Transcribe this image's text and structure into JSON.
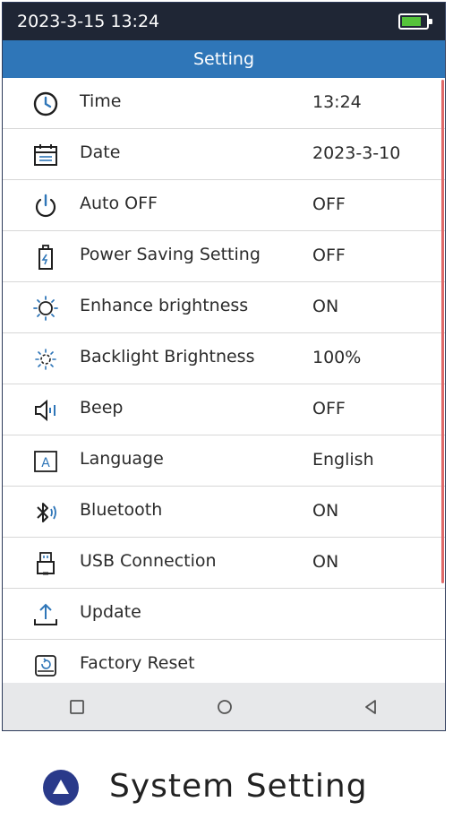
{
  "status": {
    "datetime": "2023-3-15 13:24",
    "battery_color": "#55c33b",
    "battery_level": 0.8
  },
  "header": {
    "title": "Setting"
  },
  "items": [
    {
      "icon": "clock-icon",
      "label": "Time",
      "value": "13:24"
    },
    {
      "icon": "calendar-icon",
      "label": "Date",
      "value": "2023-3-10"
    },
    {
      "icon": "power-icon",
      "label": "Auto OFF",
      "value": "OFF"
    },
    {
      "icon": "battery-saver-icon",
      "label": "Power Saving Setting",
      "value": "OFF"
    },
    {
      "icon": "brightness-enhance-icon",
      "label": "Enhance brightness",
      "value": "ON"
    },
    {
      "icon": "backlight-icon",
      "label": "Backlight Brightness",
      "value": "100%"
    },
    {
      "icon": "speaker-icon",
      "label": "Beep",
      "value": "OFF"
    },
    {
      "icon": "language-icon",
      "label": "Language",
      "value": "English"
    },
    {
      "icon": "bluetooth-icon",
      "label": "Bluetooth",
      "value": "ON"
    },
    {
      "icon": "usb-icon",
      "label": "USB Connection",
      "value": "ON"
    },
    {
      "icon": "upload-icon",
      "label": "Update",
      "value": ""
    },
    {
      "icon": "factory-reset-icon",
      "label": "Factory Reset",
      "value": ""
    }
  ],
  "language_icon_letter": "A",
  "navbar": {
    "buttons": [
      "recent-apps-icon",
      "home-icon",
      "back-icon"
    ]
  },
  "caption": {
    "text": "System Setting",
    "accent": "#2a3a8a"
  },
  "colors": {
    "status_bar": "#1f2635",
    "title_bar": "#2f76b8",
    "icon_blue": "#2f76b8",
    "scrollbar": "#e06a6a"
  }
}
